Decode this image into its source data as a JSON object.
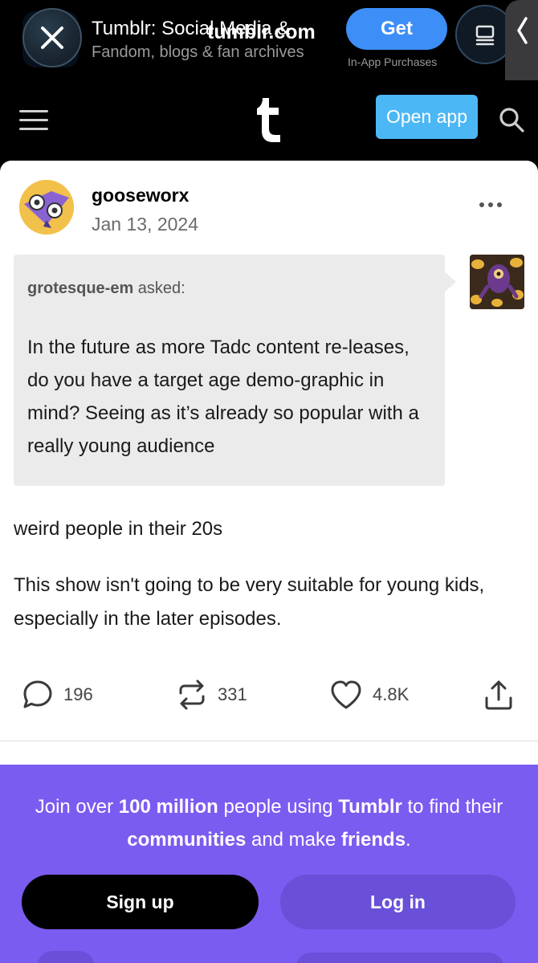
{
  "banner": {
    "app_title": "Tumblr: Social Media &",
    "site_url": "tumblr.com",
    "subtitle": "Fandom, blogs & fan archives",
    "get_label": "Get",
    "iap_label": "In-App Purchases"
  },
  "topbar": {
    "open_app_label": "Open app"
  },
  "post": {
    "username": "gooseworx",
    "date": "Jan 13, 2024",
    "ask": {
      "asker": "grotesque-em",
      "asked_suffix": " asked:",
      "text": "In the future as more Tadc content re-leases, do you have a target age demo-graphic in mind? Seeing as it’s already so popular with a really young audience"
    },
    "answer_lines": [
      "weird people in their 20s",
      "This show isn't going to be very suitable for young kids, especially in the later episodes."
    ],
    "counts": {
      "replies": "196",
      "reblogs": "331",
      "likes": "4.8K"
    }
  },
  "promo": {
    "part1": "Join over ",
    "bold1": "100 million",
    "part2": " people using ",
    "bold2": "Tumblr",
    "part3": " to find their ",
    "bold3": "communities",
    "part4": " and make ",
    "bold4": "friends",
    "part5": ".",
    "signup_label": "Sign up",
    "login_label": "Log in"
  },
  "colors": {
    "accent_blue": "#4cb7f5",
    "promo_purple": "#7b5cf0",
    "get_blue": "#3d8ef7"
  }
}
